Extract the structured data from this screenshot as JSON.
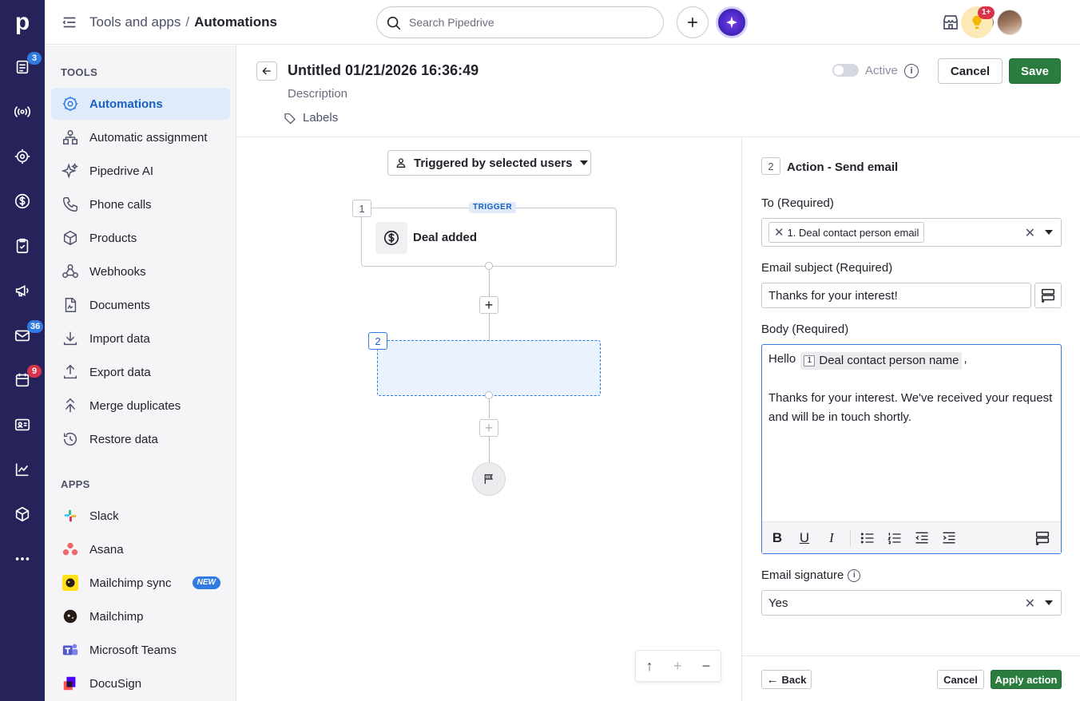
{
  "rail": {
    "logo": "p",
    "items": [
      {
        "icon": "leads-icon",
        "badge": "3"
      },
      {
        "icon": "broadcast-icon"
      },
      {
        "icon": "target-icon"
      },
      {
        "icon": "dollar-icon"
      },
      {
        "icon": "tasks-icon"
      },
      {
        "icon": "megaphone-icon"
      },
      {
        "icon": "mail-icon",
        "badge": "36"
      },
      {
        "icon": "calendar-icon",
        "badge": "9"
      },
      {
        "icon": "contacts-icon"
      },
      {
        "icon": "insights-icon"
      },
      {
        "icon": "products-icon"
      },
      {
        "icon": "more-icon"
      }
    ]
  },
  "topbar": {
    "crumb_parent": "Tools and apps",
    "crumb_sep": "/",
    "crumb_current": "Automations",
    "search_placeholder": "Search Pipedrive",
    "notification_badge": "1+"
  },
  "sidebar": {
    "tools_heading": "TOOLS",
    "tools": [
      {
        "label": "Automations",
        "icon": "automations-icon",
        "active": true
      },
      {
        "label": "Automatic assignment",
        "icon": "assignment-icon"
      },
      {
        "label": "Pipedrive AI",
        "icon": "sparkle-icon"
      },
      {
        "label": "Phone calls",
        "icon": "phone-icon"
      },
      {
        "label": "Products",
        "icon": "box-icon"
      },
      {
        "label": "Webhooks",
        "icon": "webhook-icon"
      },
      {
        "label": "Documents",
        "icon": "document-icon"
      },
      {
        "label": "Import data",
        "icon": "import-icon"
      },
      {
        "label": "Export data",
        "icon": "export-icon"
      },
      {
        "label": "Merge duplicates",
        "icon": "merge-icon"
      },
      {
        "label": "Restore data",
        "icon": "restore-icon"
      }
    ],
    "apps_heading": "APPS",
    "apps": [
      {
        "label": "Slack",
        "icon": "slack-icon"
      },
      {
        "label": "Asana",
        "icon": "asana-icon"
      },
      {
        "label": "Mailchimp sync",
        "icon": "mailchimp-icon",
        "badge": "NEW"
      },
      {
        "label": "Mailchimp",
        "icon": "mailchimp-icon"
      },
      {
        "label": "Microsoft Teams",
        "icon": "teams-icon"
      },
      {
        "label": "DocuSign",
        "icon": "docusign-icon"
      }
    ]
  },
  "workflow": {
    "title": "Untitled 01/21/2026 16:36:49",
    "description_placeholder": "Description",
    "labels": "Labels",
    "active_label": "Active",
    "active": false,
    "cancel": "Cancel",
    "save": "Save"
  },
  "canvas": {
    "trigger_select": "Triggered by selected users",
    "trigger_number": "1",
    "trigger_tag": "TRIGGER",
    "trigger_label": "Deal added",
    "action_number": "2"
  },
  "panel": {
    "step_number": "2",
    "title": "Action - Send email",
    "to_label": "To (Required)",
    "to_chip": "1. Deal contact person email",
    "subject_label": "Email subject (Required)",
    "subject_value": "Thanks for your interest!",
    "body_label": "Body (Required)",
    "body_hello": "Hello",
    "body_var_num": "1",
    "body_var_label": "Deal contact person name",
    "body_comma": ",",
    "body_paragraph": "Thanks for your interest. We've received your request and will be in touch shortly.",
    "signature_label": "Email signature",
    "signature_value": "Yes",
    "back": "Back",
    "cancel": "Cancel",
    "apply": "Apply action"
  },
  "colors": {
    "rail_bg": "#26235a",
    "accent_blue": "#317ae2",
    "save_green": "#2a7d3e",
    "active_item_bg": "#e0ebfa"
  }
}
